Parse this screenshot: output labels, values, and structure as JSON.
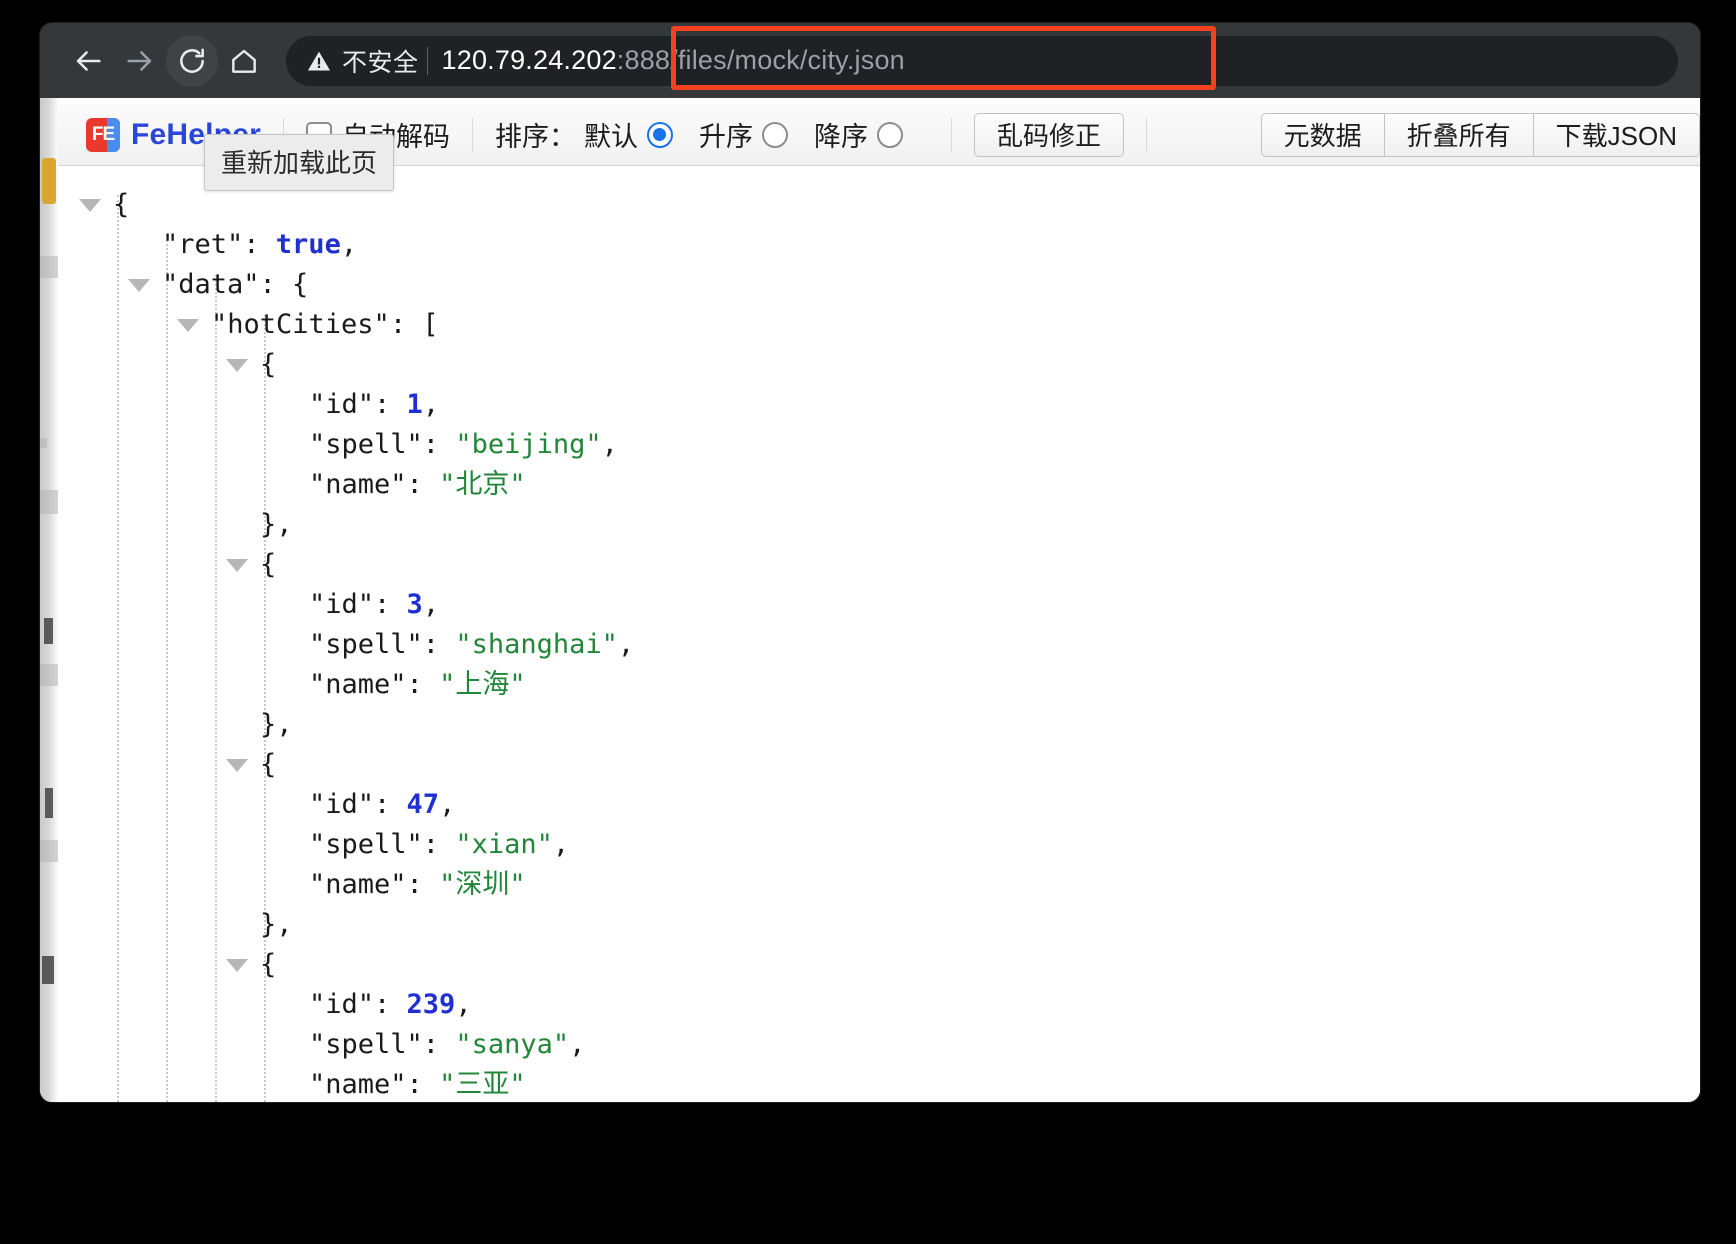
{
  "browser": {
    "nav": {
      "back_icon": "arrow-left-icon",
      "forward_icon": "arrow-right-icon",
      "reload_icon": "reload-icon",
      "home_icon": "home-icon"
    },
    "omnibox": {
      "security_icon": "warning-triangle-icon",
      "security_label": "不安全",
      "url_host": "120.79.24.202",
      "url_path": ":888/files/mock/city.json",
      "full_url": "120.79.24.202:888/files/mock/city.json"
    },
    "annotation": {
      "highlight_color": "#f5411e"
    }
  },
  "tooltip": {
    "text": "重新加载此页"
  },
  "fehelper": {
    "brand_mark": "FE",
    "brand_name": "FeHelper",
    "auto_decode_label": "自动解码",
    "auto_decode_checked": false,
    "sort": {
      "title": "排序：",
      "options": [
        {
          "label": "默认",
          "checked": true
        },
        {
          "label": "升序",
          "checked": false
        },
        {
          "label": "降序",
          "checked": false
        }
      ]
    },
    "fix_garbled_label": "乱码修正",
    "buttons": [
      {
        "label": "元数据"
      },
      {
        "label": "折叠所有"
      },
      {
        "label": "下载JSON"
      }
    ],
    "accent_color": "#2b46d8",
    "radio_color": "#1a73e8"
  },
  "json_document": {
    "syntax_colors": {
      "key": "#1a1a1a",
      "string": "#22863a",
      "number": "#1f2fd0",
      "boolean": "#1f2fd0",
      "punctuation": "#1a1a1a"
    },
    "lines": [
      {
        "indent": 0,
        "arrow": true,
        "tokens": [
          {
            "t": "{",
            "c": "p"
          }
        ]
      },
      {
        "indent": 1,
        "arrow": false,
        "tokens": [
          {
            "t": "\"ret\"",
            "c": "k"
          },
          {
            "t": ": ",
            "c": "p"
          },
          {
            "t": "true",
            "c": "b"
          },
          {
            "t": ",",
            "c": "p"
          }
        ]
      },
      {
        "indent": 1,
        "arrow": true,
        "tokens": [
          {
            "t": "\"data\"",
            "c": "k"
          },
          {
            "t": ": {",
            "c": "p"
          }
        ]
      },
      {
        "indent": 2,
        "arrow": true,
        "tokens": [
          {
            "t": "\"hotCities\"",
            "c": "k"
          },
          {
            "t": ": [",
            "c": "p"
          }
        ]
      },
      {
        "indent": 3,
        "arrow": true,
        "tokens": [
          {
            "t": "{",
            "c": "p"
          }
        ]
      },
      {
        "indent": 4,
        "arrow": false,
        "tokens": [
          {
            "t": "\"id\"",
            "c": "k"
          },
          {
            "t": ": ",
            "c": "p"
          },
          {
            "t": "1",
            "c": "n"
          },
          {
            "t": ",",
            "c": "p"
          }
        ]
      },
      {
        "indent": 4,
        "arrow": false,
        "tokens": [
          {
            "t": "\"spell\"",
            "c": "k"
          },
          {
            "t": ": ",
            "c": "p"
          },
          {
            "t": "\"beijing\"",
            "c": "s"
          },
          {
            "t": ",",
            "c": "p"
          }
        ]
      },
      {
        "indent": 4,
        "arrow": false,
        "tokens": [
          {
            "t": "\"name\"",
            "c": "k"
          },
          {
            "t": ": ",
            "c": "p"
          },
          {
            "t": "\"北京\"",
            "c": "s"
          }
        ]
      },
      {
        "indent": 3,
        "arrow": false,
        "tokens": [
          {
            "t": "},",
            "c": "p"
          }
        ]
      },
      {
        "indent": 3,
        "arrow": true,
        "tokens": [
          {
            "t": "{",
            "c": "p"
          }
        ]
      },
      {
        "indent": 4,
        "arrow": false,
        "tokens": [
          {
            "t": "\"id\"",
            "c": "k"
          },
          {
            "t": ": ",
            "c": "p"
          },
          {
            "t": "3",
            "c": "n"
          },
          {
            "t": ",",
            "c": "p"
          }
        ]
      },
      {
        "indent": 4,
        "arrow": false,
        "tokens": [
          {
            "t": "\"spell\"",
            "c": "k"
          },
          {
            "t": ": ",
            "c": "p"
          },
          {
            "t": "\"shanghai\"",
            "c": "s"
          },
          {
            "t": ",",
            "c": "p"
          }
        ]
      },
      {
        "indent": 4,
        "arrow": false,
        "tokens": [
          {
            "t": "\"name\"",
            "c": "k"
          },
          {
            "t": ": ",
            "c": "p"
          },
          {
            "t": "\"上海\"",
            "c": "s"
          }
        ]
      },
      {
        "indent": 3,
        "arrow": false,
        "tokens": [
          {
            "t": "},",
            "c": "p"
          }
        ]
      },
      {
        "indent": 3,
        "arrow": true,
        "tokens": [
          {
            "t": "{",
            "c": "p"
          }
        ]
      },
      {
        "indent": 4,
        "arrow": false,
        "tokens": [
          {
            "t": "\"id\"",
            "c": "k"
          },
          {
            "t": ": ",
            "c": "p"
          },
          {
            "t": "47",
            "c": "n"
          },
          {
            "t": ",",
            "c": "p"
          }
        ]
      },
      {
        "indent": 4,
        "arrow": false,
        "tokens": [
          {
            "t": "\"spell\"",
            "c": "k"
          },
          {
            "t": ": ",
            "c": "p"
          },
          {
            "t": "\"xian\"",
            "c": "s"
          },
          {
            "t": ",",
            "c": "p"
          }
        ]
      },
      {
        "indent": 4,
        "arrow": false,
        "tokens": [
          {
            "t": "\"name\"",
            "c": "k"
          },
          {
            "t": ": ",
            "c": "p"
          },
          {
            "t": "\"深圳\"",
            "c": "s"
          }
        ]
      },
      {
        "indent": 3,
        "arrow": false,
        "tokens": [
          {
            "t": "},",
            "c": "p"
          }
        ]
      },
      {
        "indent": 3,
        "arrow": true,
        "tokens": [
          {
            "t": "{",
            "c": "p"
          }
        ]
      },
      {
        "indent": 4,
        "arrow": false,
        "tokens": [
          {
            "t": "\"id\"",
            "c": "k"
          },
          {
            "t": ": ",
            "c": "p"
          },
          {
            "t": "239",
            "c": "n"
          },
          {
            "t": ",",
            "c": "p"
          }
        ]
      },
      {
        "indent": 4,
        "arrow": false,
        "tokens": [
          {
            "t": "\"spell\"",
            "c": "k"
          },
          {
            "t": ": ",
            "c": "p"
          },
          {
            "t": "\"sanya\"",
            "c": "s"
          },
          {
            "t": ",",
            "c": "p"
          }
        ]
      },
      {
        "indent": 4,
        "arrow": false,
        "tokens": [
          {
            "t": "\"name\"",
            "c": "k"
          },
          {
            "t": ": ",
            "c": "p"
          },
          {
            "t": "\"三亚\"",
            "c": "s"
          }
        ]
      },
      {
        "indent": 3,
        "arrow": false,
        "tokens": [
          {
            "t": "},",
            "c": "p"
          }
        ]
      },
      {
        "indent": 3,
        "arrow": true,
        "tokens": [
          {
            "t": "{",
            "c": "p"
          }
        ]
      }
    ]
  }
}
